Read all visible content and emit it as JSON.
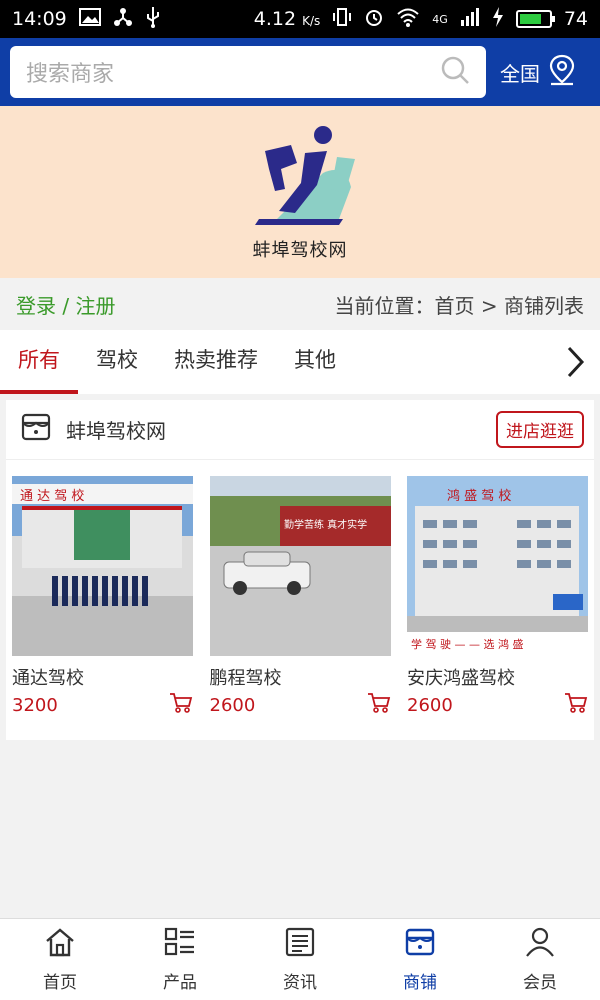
{
  "status_bar": {
    "time": "14:09",
    "speed": "4.12",
    "speed_unit": "K/s",
    "network": "4G",
    "battery": "74",
    "battery_level": 0.74
  },
  "search": {
    "placeholder": "搜索商家",
    "region_label": "全国"
  },
  "banner": {
    "site_name": "蚌埠驾校网"
  },
  "breadcrumb": {
    "login_register": "登录 / 注册",
    "location_prefix": "当前位置：",
    "home": "首页",
    "separator": ">",
    "current": "商铺列表"
  },
  "tabs": [
    {
      "label": "所有",
      "active": true
    },
    {
      "label": "驾校",
      "active": false
    },
    {
      "label": "热卖推荐",
      "active": false
    },
    {
      "label": "其他",
      "active": false
    }
  ],
  "shop": {
    "name": "蚌埠驾校网",
    "visit_button": "进店逛逛",
    "products": [
      {
        "name": "通达驾校",
        "price": "3200",
        "sign_text": "通 达   驾 校"
      },
      {
        "name": "鹏程驾校",
        "price": "2600",
        "sign_text": "勤学苦练 真才实学"
      },
      {
        "name": "安庆鸿盛驾校",
        "price": "2600",
        "sign_text": "学 驾 驶 — — 选 鸿 盛",
        "roof_text": "鸿 盛   驾 校"
      }
    ]
  },
  "bottom_nav": [
    {
      "label": "首页",
      "icon": "home-icon",
      "active": false
    },
    {
      "label": "产品",
      "icon": "product-list-icon",
      "active": false
    },
    {
      "label": "资讯",
      "icon": "news-icon",
      "active": false
    },
    {
      "label": "商铺",
      "icon": "shop-icon",
      "active": true
    },
    {
      "label": "会员",
      "icon": "member-icon",
      "active": false
    }
  ],
  "colors": {
    "brand_blue": "#0f3ea6",
    "accent_red": "#c0161c",
    "login_green": "#3a9a2a",
    "banner_bg": "#fce3cc"
  }
}
